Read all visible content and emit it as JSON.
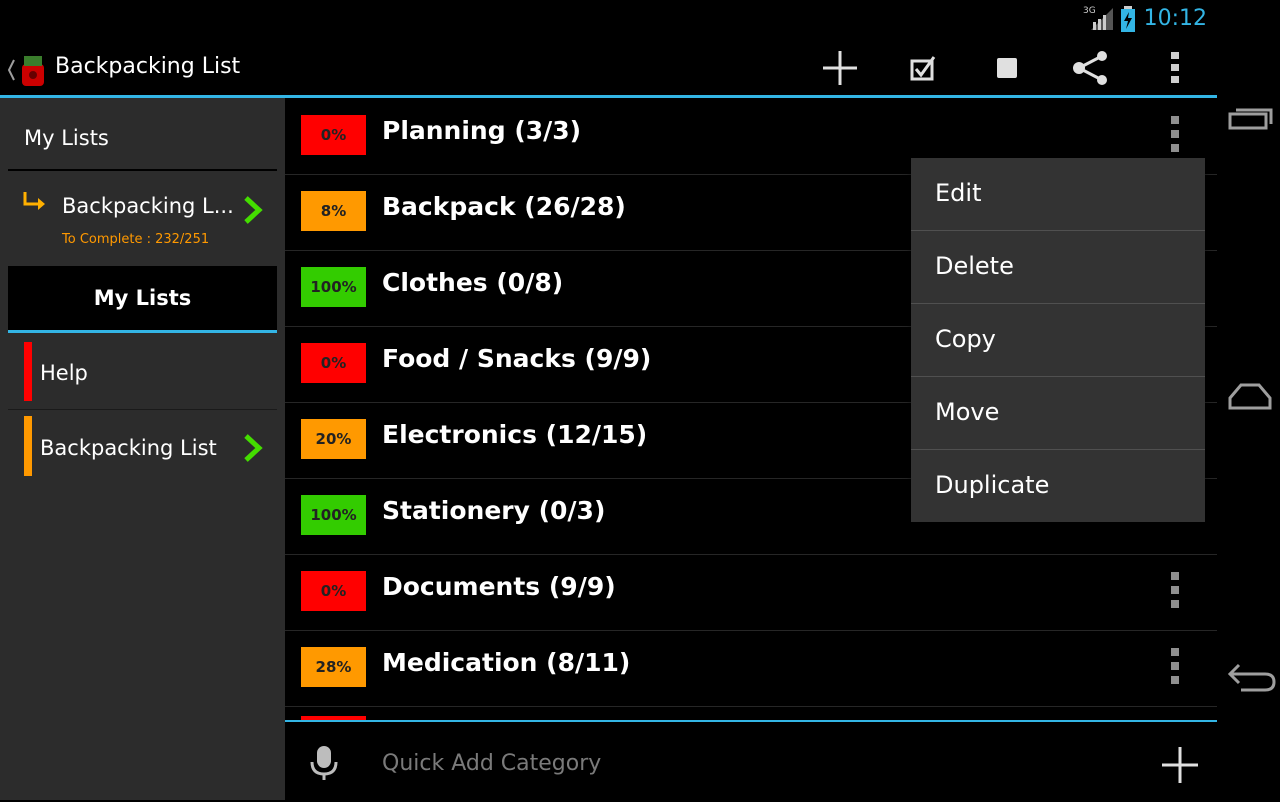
{
  "status_bar": {
    "network": "3G",
    "time": "10:12"
  },
  "action_bar": {
    "title": "Backpacking List",
    "icons": [
      "add-icon",
      "check-all-icon",
      "uncheck-all-icon",
      "share-icon",
      "overflow-menu-icon"
    ]
  },
  "sidebar": {
    "header": "My Lists",
    "current": {
      "name": "Backpacking L...",
      "progress": "To Complete : 232/251"
    },
    "section_title": "My Lists",
    "items": [
      {
        "label": "Help",
        "color": "#ff0000"
      },
      {
        "label": "Backpacking List",
        "color": "#ff9900"
      }
    ]
  },
  "categories": [
    {
      "percent": "0%",
      "label": "Planning (3/3)",
      "color": "#ff0000"
    },
    {
      "percent": "8%",
      "label": "Backpack (26/28)",
      "color": "#ff9900"
    },
    {
      "percent": "100%",
      "label": "Clothes (0/8)",
      "color": "#33cc00"
    },
    {
      "percent": "0%",
      "label": "Food / Snacks (9/9)",
      "color": "#ff0000"
    },
    {
      "percent": "20%",
      "label": "Electronics (12/15)",
      "color": "#ff9900"
    },
    {
      "percent": "100%",
      "label": "Stationery (0/3)",
      "color": "#33cc00"
    },
    {
      "percent": "0%",
      "label": "Documents (9/9)",
      "color": "#ff0000"
    },
    {
      "percent": "28%",
      "label": "Medication (8/11)",
      "color": "#ff9900"
    }
  ],
  "context_menu": {
    "items": [
      "Edit",
      "Delete",
      "Copy",
      "Move",
      "Duplicate"
    ]
  },
  "quick_add": {
    "placeholder": "Quick Add Category"
  },
  "colors": {
    "accent": "#33b5e5",
    "red": "#ff0000",
    "orange": "#ff9900",
    "green": "#33cc00"
  }
}
